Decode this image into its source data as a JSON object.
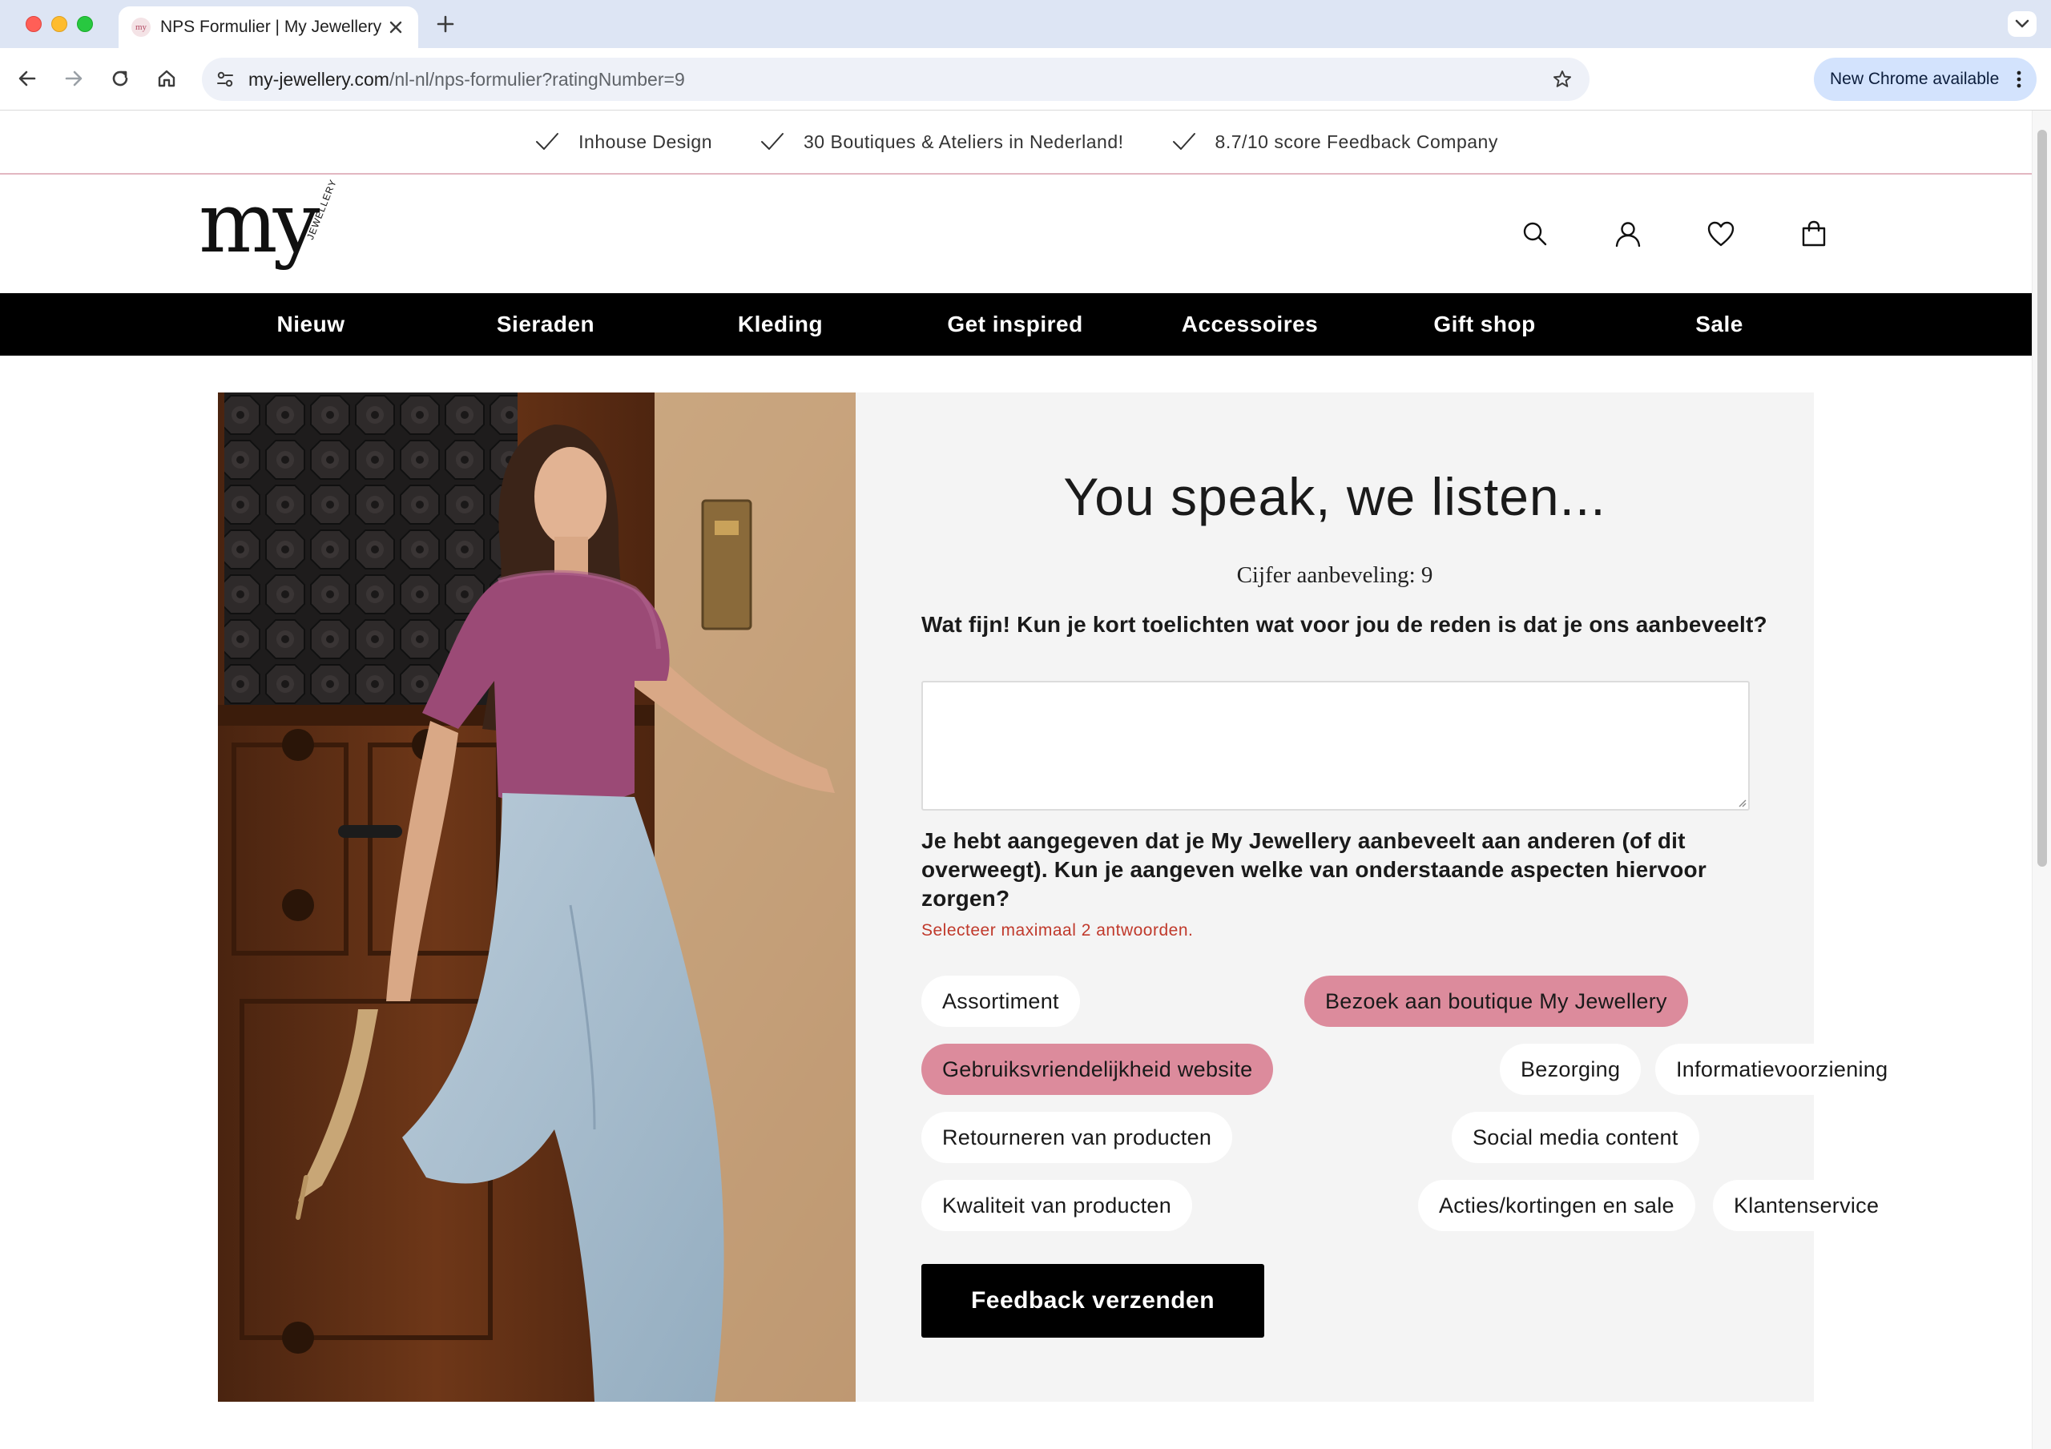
{
  "browser": {
    "tab_title": "NPS Formulier | My Jewellery",
    "url_host": "my-jewellery.com",
    "url_path": "/nl-nl/nps-formulier?ratingNumber=9",
    "update_label": "New Chrome available",
    "favicon_text": "my"
  },
  "usps": [
    {
      "label": "Inhouse Design",
      "icon": "check-icon"
    },
    {
      "label": "30 Boutiques & Ateliers in Nederland!",
      "icon": "check-icon"
    },
    {
      "label": "8.7/10 score Feedback Company",
      "icon": "check-icon"
    }
  ],
  "logo": {
    "main": "my",
    "sub": "JEWELLERY"
  },
  "header_icons": [
    "search-icon",
    "account-icon",
    "heart-icon",
    "bag-icon"
  ],
  "nav": [
    "Nieuw",
    "Sieraden",
    "Kleding",
    "Get inspired",
    "Accessoires",
    "Gift shop",
    "Sale"
  ],
  "form": {
    "title": "You speak, we listen...",
    "rating": "Cijfer aanbeveling: 9",
    "question1": "Wat fijn! Kun je kort toelichten wat voor jou de reden is dat je ons aanbeveelt?",
    "textarea_value": "",
    "question2": "Je hebt aangegeven dat je My Jewellery aanbeveelt aan anderen (of dit overweegt). Kun je aangeven welke van onderstaande aspecten hiervoor zorgen?",
    "hint": "Selecteer maximaal 2 antwoorden.",
    "options": [
      {
        "label": "Assortiment",
        "selected": false
      },
      {
        "label": "Bezoek aan boutique My Jewellery",
        "selected": true
      },
      {
        "label": "Gebruiksvriendelijkheid website",
        "selected": true
      },
      {
        "label": "Bezorging",
        "selected": false
      },
      {
        "label": "Informatievoorziening",
        "selected": false
      },
      {
        "label": "Retourneren van producten",
        "selected": false
      },
      {
        "label": "Social media content",
        "selected": false
      },
      {
        "label": "Kwaliteit van producten",
        "selected": false
      },
      {
        "label": "Acties/kortingen en sale",
        "selected": false
      },
      {
        "label": "Klantenservice",
        "selected": false
      }
    ],
    "submit_label": "Feedback verzenden"
  },
  "colors": {
    "accent_pink": "#dc8b9c",
    "hint_red": "#c0392b",
    "nav_bg": "#000000",
    "usp_border": "#e2b7c1"
  }
}
